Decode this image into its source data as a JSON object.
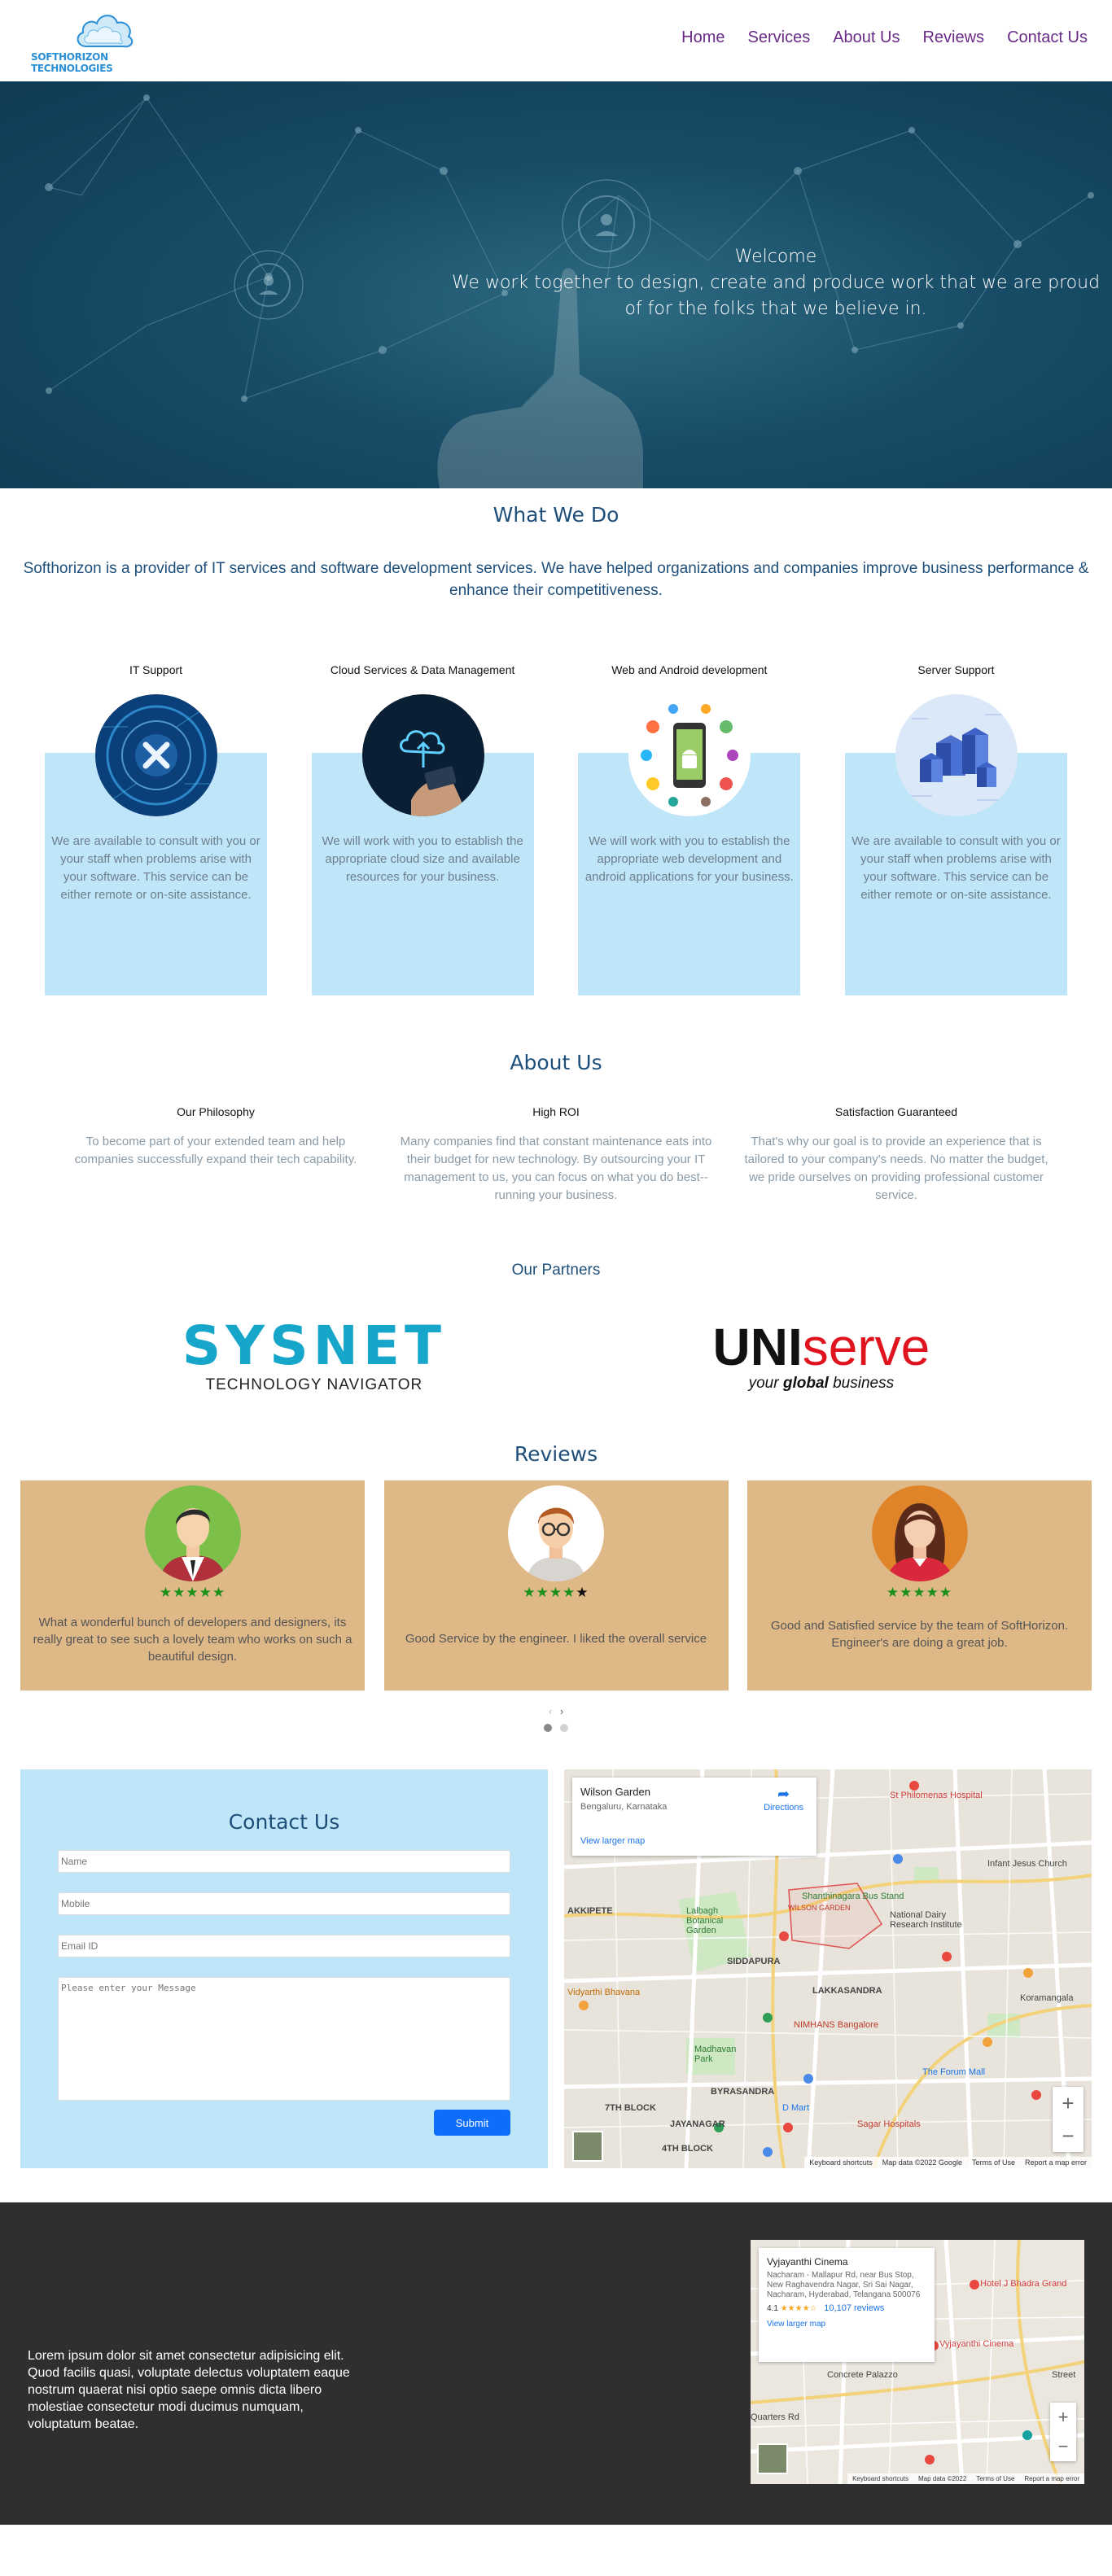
{
  "brand": {
    "name": "SOFTHORIZON TECHNOLOGIES"
  },
  "nav": {
    "items": [
      "Home",
      "Services",
      "About Us",
      "Reviews",
      "Contact Us"
    ]
  },
  "hero": {
    "welcome": "Welcome",
    "tagline": "We work together to design, create and produce work that we are proud of for the folks that we believe in."
  },
  "what_we_do": {
    "heading": "What We Do",
    "intro": "Softhorizon is a provider of IT services and software development services. We have helped organizations and companies improve business performance & enhance their competitiveness.",
    "services": [
      {
        "title": "IT Support",
        "desc": "We are available to consult with you or your staff when problems arise with your software. This service can be either remote or on-site assistance."
      },
      {
        "title": "Cloud Services & Data Management",
        "desc": "We will work with you to establish the appropriate cloud size and available resources for your business."
      },
      {
        "title": "Web and Android development",
        "desc": "We will work with you to establish the appropriate web development and android applications for your business."
      },
      {
        "title": "Server Support",
        "desc": "We are available to consult with you or your staff when problems arise with your software. This service can be either remote or on-site assistance."
      }
    ]
  },
  "about": {
    "heading": "About Us",
    "cols": [
      {
        "title": "Our Philosophy",
        "text": "To become part of your extended team and help companies successfully expand their tech capability."
      },
      {
        "title": "High ROI",
        "text": "Many companies find that constant maintenance eats into their budget for new technology. By outsourcing your IT management to us, you can focus on what you do best--running your business."
      },
      {
        "title": "Satisfaction Guaranteed",
        "text": "That's why our goal is to provide an experience that is tailored to your company's needs. No matter the budget, we pride ourselves on providing professional customer service."
      }
    ]
  },
  "partners": {
    "heading": "Our Partners",
    "sysnet": {
      "name": "SYSNET",
      "tag": "TECHNOLOGY NAVIGATOR"
    },
    "uniserve": {
      "name_a": "UNI",
      "name_b": "serve",
      "tag_a": "your ",
      "tag_b": "global",
      "tag_c": " business"
    }
  },
  "reviews": {
    "heading": "Reviews",
    "items": [
      {
        "stars": 5,
        "text": "What a wonderful bunch of developers and designers, its really great to see such a lovely team who works on such a beautiful design."
      },
      {
        "stars": 4,
        "text": "Good Service by the engineer. I liked the overall service"
      },
      {
        "stars": 5,
        "text": "Good and Satisfied service by the team of SoftHorizon. Engineer's are doing a great job."
      }
    ],
    "prev": "‹",
    "next": "›"
  },
  "contact": {
    "heading": "Contact Us",
    "name_ph": "Name",
    "mobile_ph": "Mobile",
    "email_ph": "Email ID",
    "message_ph": "Please enter your Message",
    "submit": "Submit"
  },
  "map1": {
    "place": "Wilson Garden",
    "area": "Bengaluru, Karnataka",
    "directions": "Directions",
    "larger": "View larger map",
    "footer": [
      "Keyboard shortcuts",
      "Map data ©2022 Google",
      "Terms of Use",
      "Report a map error"
    ],
    "labels": [
      "St Philomenas Hospital",
      "Shanthinagara Bus Stand",
      "Lalbagh Botanical Garden",
      "WILSON GARDEN",
      "LAKKASANDRA",
      "NIMHANS Bangalore",
      "Madhavan Park",
      "National Dairy Research Institute",
      "The Forum Mall",
      "Vidyarthi Bhavana",
      "Koramangala",
      "D Mart",
      "Sagar Hospitals",
      "Infant Jesus Church",
      "4TH BLOCK",
      "7TH BLOCK",
      "JAYANAGAR",
      "SIDDAPURA",
      "BYRASANDRA",
      "AKKIPETE"
    ]
  },
  "footer": {
    "lorem": "Lorem ipsum dolor sit amet consectetur adipisicing elit. Quod facilis quasi, voluptate delectus voluptatem eaque nostrum quaerat nisi optio saepe omnis dicta libero molestiae consectetur modi ducimus numquam, voluptatum beatae."
  },
  "map2": {
    "place": "Vyjayanthi Cinema",
    "address": "Nacharam - Mallapur Rd, near Bus Stop, New Raghavendra Nagar, Sri Sai Nagar, Nacharam, Hyderabad, Telangana 500076",
    "rating": "4.1",
    "reviews": "10,107 reviews",
    "larger": "View larger map",
    "labels": [
      "Hotel J Bhadra Grand",
      "Vyjayanthi Cinema",
      "Concrete Palazzo",
      "Quarters Rd",
      "Street"
    ],
    "footer": [
      "Keyboard shortcuts",
      "Map data ©2022",
      "Terms of Use",
      "Report a map error"
    ]
  },
  "colors": {
    "nav": "#6a2b87",
    "heading": "#1e4f7a",
    "panel": "#bfe6f8",
    "review": "#deb887",
    "footer": "#2f2f31"
  }
}
